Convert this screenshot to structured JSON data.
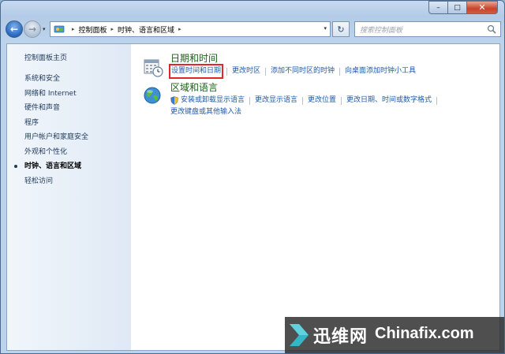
{
  "window": {
    "minimize": "–",
    "maximize": "□",
    "close": "✕"
  },
  "nav": {
    "back_glyph": "←",
    "forward_glyph": "→",
    "dropdown_glyph": "▾",
    "breadcrumbs": [
      "控制面板",
      "时钟、语言和区域"
    ],
    "crumb_separator": "▸",
    "refresh_glyph": "↻",
    "search_placeholder": "搜索控制面板"
  },
  "sidebar": {
    "home": "控制面板主页",
    "items": [
      {
        "label": "系统和安全",
        "active": false
      },
      {
        "label": "网络和 Internet",
        "active": false
      },
      {
        "label": "硬件和声音",
        "active": false
      },
      {
        "label": "程序",
        "active": false
      },
      {
        "label": "用户帐户和家庭安全",
        "active": false
      },
      {
        "label": "外观和个性化",
        "active": false
      },
      {
        "label": "时钟、语言和区域",
        "active": true
      },
      {
        "label": "轻松访问",
        "active": false
      }
    ]
  },
  "sections": [
    {
      "title": "日期和时间",
      "icon": "calendar-clock-icon",
      "links": [
        "设置时间和日期",
        "更改时区",
        "添加不同时区的时钟",
        "向桌面添加时钟小工具"
      ]
    },
    {
      "title": "区域和语言",
      "icon": "globe-icon",
      "links": [
        "安装或卸载显示语言",
        "更改显示语言",
        "更改位置",
        "更改日期、时间或数字格式",
        "更改键盘或其他输入法"
      ]
    }
  ],
  "watermark": {
    "cn": "迅维网",
    "en": "Chinafix.com"
  },
  "colors": {
    "section_title": "#1e5f19",
    "link": "#1f5ba8",
    "highlight_box": "#e2262a"
  }
}
